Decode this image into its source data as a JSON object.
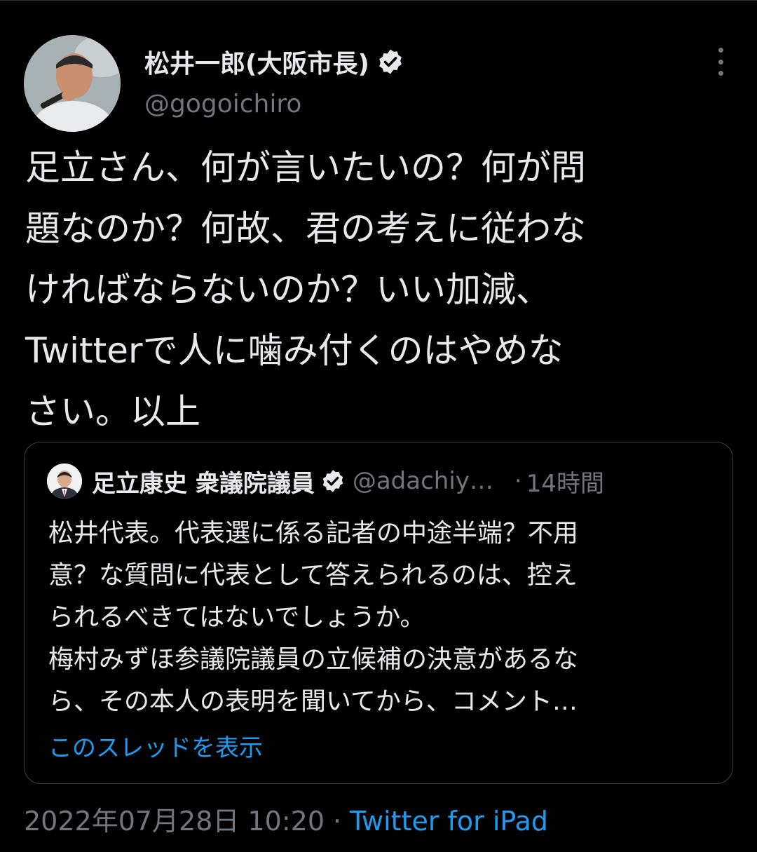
{
  "tweet": {
    "author_name": "松井一郎(大阪市長)",
    "author_handle": "@gogoichiro",
    "text": "足立さん、何が言いたいの？何が問\n題なのか？何故、君の考えに従わな\nければならないのか？いい加減、\nTwitterで人に噛み付くのはやめな\nさい。以上",
    "timestamp": "2022年07月28日 10:20",
    "separator": "·",
    "source": "Twitter for iPad",
    "verified_icon": "verified-badge-icon",
    "more_icon": "more-options-icon"
  },
  "quote": {
    "author_name": "足立康史 衆議院議員",
    "author_handle": "@adachiy…",
    "separator": "·",
    "time": "14時間",
    "text": "松井代表。代表選に係る記者の中途半端？不用\n意？な質問に代表として答えられるのは、控え\nられるべきてはないでしょうか。\n梅村みずほ参議院議員の立候補の決意があるな\nら、その本人の表明を聞いてから、コメント…",
    "show_thread_label": "このスレッドを表示"
  },
  "colors": {
    "background": "#000000",
    "text": "#e7e9ea",
    "secondary": "#71767b",
    "accent": "#1d9bf0"
  }
}
